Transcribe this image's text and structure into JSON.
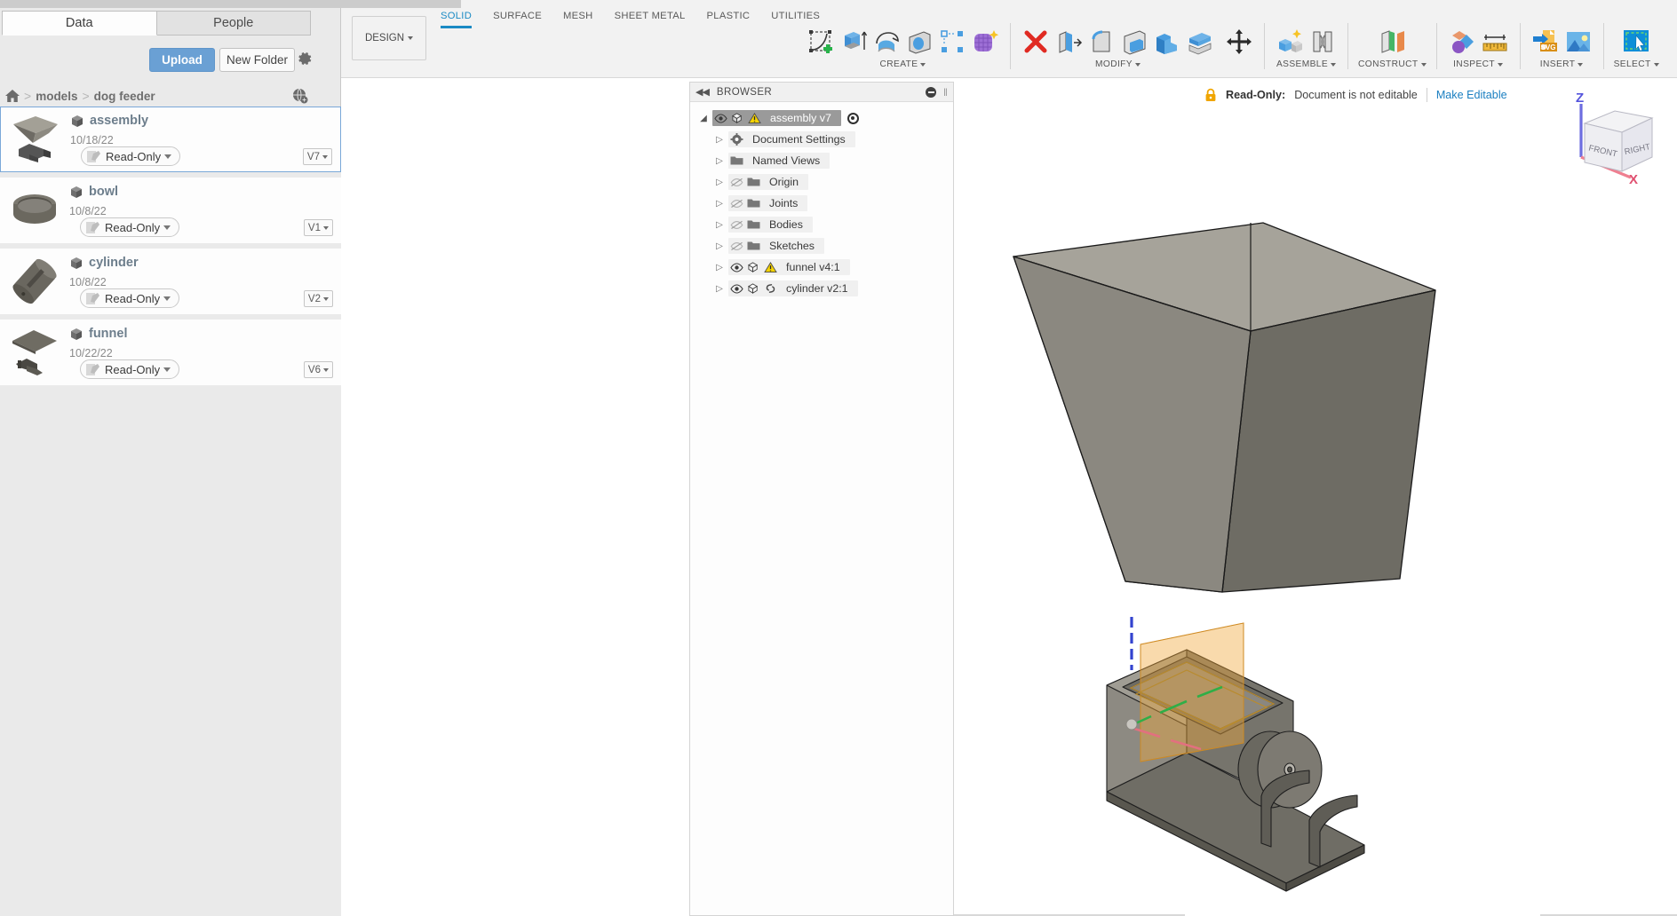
{
  "data_panel": {
    "tabs": [
      {
        "label": "Data",
        "active": true
      },
      {
        "label": "People",
        "active": false
      }
    ],
    "upload_label": "Upload",
    "new_folder_label": "New Folder",
    "settings_icon": "gear-icon",
    "globe_icon": "globe-icon",
    "breadcrumb": {
      "home_icon": "home-icon",
      "items": [
        "models",
        "dog feeder"
      ],
      "separator": ">"
    },
    "files": [
      {
        "name": "assembly",
        "date": "10/18/22",
        "permission": "Read-Only",
        "version": "V7",
        "selected": true,
        "thumb": "assembly-thumbnail"
      },
      {
        "name": "bowl",
        "date": "10/8/22",
        "permission": "Read-Only",
        "version": "V1",
        "selected": false,
        "thumb": "bowl-thumbnail"
      },
      {
        "name": "cylinder",
        "date": "10/8/22",
        "permission": "Read-Only",
        "version": "V2",
        "selected": false,
        "thumb": "cylinder-thumbnail"
      },
      {
        "name": "funnel",
        "date": "10/22/22",
        "permission": "Read-Only",
        "version": "V6",
        "selected": false,
        "thumb": "funnel-thumbnail"
      }
    ]
  },
  "toolbar": {
    "workspace_label": "DESIGN",
    "ribbon_tabs": [
      {
        "label": "SOLID",
        "active": true
      },
      {
        "label": "SURFACE",
        "active": false
      },
      {
        "label": "MESH",
        "active": false
      },
      {
        "label": "SHEET METAL",
        "active": false
      },
      {
        "label": "PLASTIC",
        "active": false
      },
      {
        "label": "UTILITIES",
        "active": false
      }
    ],
    "panels": [
      {
        "title": "CREATE",
        "has_dropdown": true,
        "tools": [
          "create-sketch-icon",
          "extrude-icon",
          "revolve-icon",
          "hole-icon",
          "rectangular-pattern-icon",
          "form-icon"
        ]
      },
      {
        "title": "MODIFY",
        "has_dropdown": true,
        "tools": [
          "delete-icon",
          "press-pull-icon",
          "fillet-icon",
          "shell-icon",
          "combine-icon",
          "offset-face-icon"
        ]
      },
      {
        "title": "",
        "has_dropdown": false,
        "tools": [
          "move-copy-icon"
        ]
      },
      {
        "title": "ASSEMBLE",
        "has_dropdown": true,
        "tools": [
          "new-component-icon",
          "joint-icon"
        ]
      },
      {
        "title": "CONSTRUCT",
        "has_dropdown": true,
        "tools": [
          "offset-plane-icon"
        ]
      },
      {
        "title": "INSPECT",
        "has_dropdown": true,
        "tools": [
          "interference-icon",
          "measure-icon"
        ]
      },
      {
        "title": "INSERT",
        "has_dropdown": true,
        "tools": [
          "insert-svg-icon",
          "insert-image-icon"
        ]
      },
      {
        "title": "SELECT",
        "has_dropdown": true,
        "tools": [
          "select-window-icon"
        ]
      }
    ]
  },
  "browser": {
    "title": "BROWSER",
    "collapse_icon": "collapse-left-icon",
    "minimize_icon": "minus-circle-icon",
    "root": {
      "label": "assembly v7",
      "selected": true,
      "icons": [
        "eye-icon",
        "component-icon",
        "warning-icon"
      ],
      "trailing_icon": "activate-radio-icon",
      "expanded": true
    },
    "nodes": [
      {
        "label": "Document Settings",
        "icon": "gear-icon",
        "visibility": null,
        "extra_icon": null
      },
      {
        "label": "Named Views",
        "icon": "folder-icon",
        "visibility": null,
        "extra_icon": null
      },
      {
        "label": "Origin",
        "icon": "folder-icon",
        "visibility": "eye-off-icon",
        "extra_icon": null
      },
      {
        "label": "Joints",
        "icon": "folder-icon",
        "visibility": "eye-off-icon",
        "extra_icon": null
      },
      {
        "label": "Bodies",
        "icon": "folder-icon",
        "visibility": "eye-off-icon",
        "extra_icon": null
      },
      {
        "label": "Sketches",
        "icon": "folder-icon",
        "visibility": "eye-off-icon",
        "extra_icon": null
      },
      {
        "label": "funnel v4:1",
        "icon": "component-icon",
        "visibility": "eye-on-icon",
        "extra_icon": "warning-icon"
      },
      {
        "label": "cylinder v2:1",
        "icon": "component-icon",
        "visibility": "eye-on-icon",
        "extra_icon": "link-icon"
      }
    ]
  },
  "read_only_banner": {
    "lock_icon": "lock-icon",
    "label": "Read-Only:",
    "message": "Document is not editable",
    "action_link": "Make Editable"
  },
  "viewcube": {
    "faces": [
      "FRONT",
      "RIGHT"
    ],
    "axes": [
      {
        "label": "Z",
        "color": "#5555dd"
      },
      {
        "label": "X",
        "color": "#e05070"
      }
    ]
  },
  "viewport": {
    "models": [
      {
        "name": "funnel-body",
        "description": "tapered rectangular hopper"
      },
      {
        "name": "cylinder-assembly",
        "description": "box with dispenser wheel and base plate"
      }
    ],
    "colors": {
      "body_light": "#a9a69c",
      "body_mid": "#8b8880",
      "body_dark": "#6f6d66",
      "sketch_plane": "#f4b942",
      "axis_z": "#3c50d0",
      "axis_y": "#35b04a",
      "axis_x": "#e0707f",
      "accent": "#1a8ac4"
    }
  }
}
